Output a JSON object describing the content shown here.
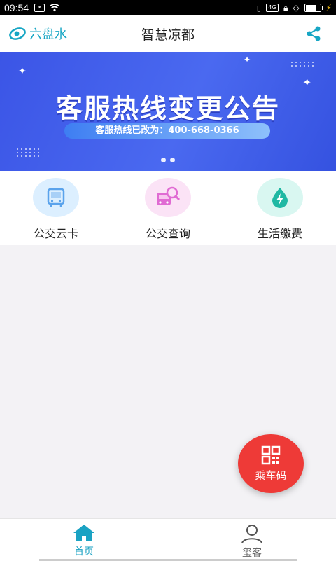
{
  "status_bar": {
    "time": "09:54",
    "notification_icons": [
      "x-box-icon",
      "wifi-icon"
    ],
    "system_icons": [
      "vibrate-icon",
      "data-icon",
      "lock-icon",
      "location-icon",
      "battery-icon",
      "charging-icon"
    ]
  },
  "header": {
    "brand": "六盘水",
    "title": "智慧凉都",
    "share_icon": "share-icon"
  },
  "banner": {
    "headline": "客服热线变更公告",
    "subtitle": "客服热线已改为：400-668-0366",
    "slide_count": 2
  },
  "quick_actions": [
    {
      "label": "公交云卡",
      "icon": "bus-card-icon",
      "color": "#dcefff"
    },
    {
      "label": "公交查询",
      "icon": "bus-search-icon",
      "color": "#fbe3f6"
    },
    {
      "label": "生活缴费",
      "icon": "water-bolt-icon",
      "color": "#d9f7f1"
    }
  ],
  "fab": {
    "label": "乘车码",
    "icon": "qr-code-icon",
    "color": "#ee3a37"
  },
  "bottom_nav": [
    {
      "label": "首页",
      "icon": "home-icon",
      "active": true
    },
    {
      "label": "玺客",
      "icon": "user-icon",
      "active": false
    }
  ],
  "colors": {
    "brand": "#17a6c4",
    "banner": "#4a69f0"
  }
}
